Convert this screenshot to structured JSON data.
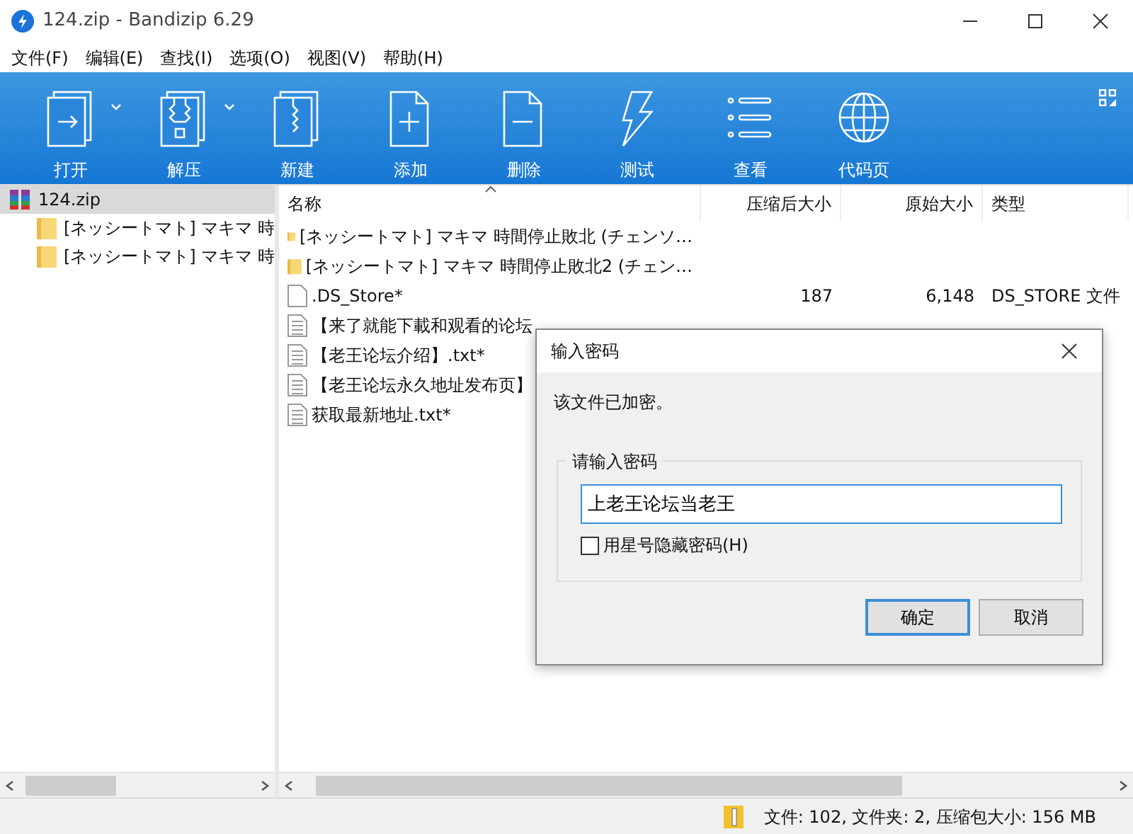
{
  "window": {
    "title": "124.zip - Bandizip 6.29"
  },
  "menu": [
    "文件(F)",
    "编辑(E)",
    "查找(I)",
    "选项(O)",
    "视图(V)",
    "帮助(H)"
  ],
  "toolbar": [
    {
      "label": "打开",
      "dropdown": true
    },
    {
      "label": "解压",
      "dropdown": true
    },
    {
      "label": "新建",
      "dropdown": false
    },
    {
      "label": "添加",
      "dropdown": false
    },
    {
      "label": "删除",
      "dropdown": false
    },
    {
      "label": "测试",
      "dropdown": false
    },
    {
      "label": "查看",
      "dropdown": false
    },
    {
      "label": "代码页",
      "dropdown": false
    }
  ],
  "tree": [
    {
      "label": "124.zip",
      "selected": true,
      "kind": "archive",
      "children": [
        {
          "label": "[ネッシートマト] マキマ 時",
          "selected": false,
          "kind": "folder"
        },
        {
          "label": "[ネッシートマト] マキマ 時",
          "selected": false,
          "kind": "folder"
        }
      ]
    }
  ],
  "table": {
    "columns": [
      "名称",
      "压缩后大小",
      "原始大小",
      "类型"
    ],
    "rows": [
      {
        "kind": "folder",
        "name": "[ネッシートマト] マキマ 時間停止敗北 (チェンソ…"
      },
      {
        "kind": "folder",
        "name": "[ネッシートマト] マキマ 時間停止敗北2 (チェン…"
      },
      {
        "kind": "blank",
        "name": ".DS_Store*",
        "packed": "187",
        "size": "6,148",
        "type": "DS_STORE 文件"
      },
      {
        "kind": "text",
        "name": "【来了就能下載和观看的论坛"
      },
      {
        "kind": "text",
        "name": "【老王论坛介绍】.txt*"
      },
      {
        "kind": "text",
        "name": "【老王论坛永久地址发布页】"
      },
      {
        "kind": "text",
        "name": "获取最新地址.txt*"
      }
    ]
  },
  "status_bar": "文件: 102, 文件夹: 2, 压缩包大小: 156 MB",
  "dialog": {
    "title": "输入密码",
    "message": "该文件已加密。",
    "group": "请输入密码",
    "password": "上老王论坛当老王",
    "mask_label": "用星号隐藏密码(H)",
    "mask": false,
    "buttons": [
      {
        "label": "确定",
        "default": true
      },
      {
        "label": "取消",
        "default": false
      }
    ]
  }
}
